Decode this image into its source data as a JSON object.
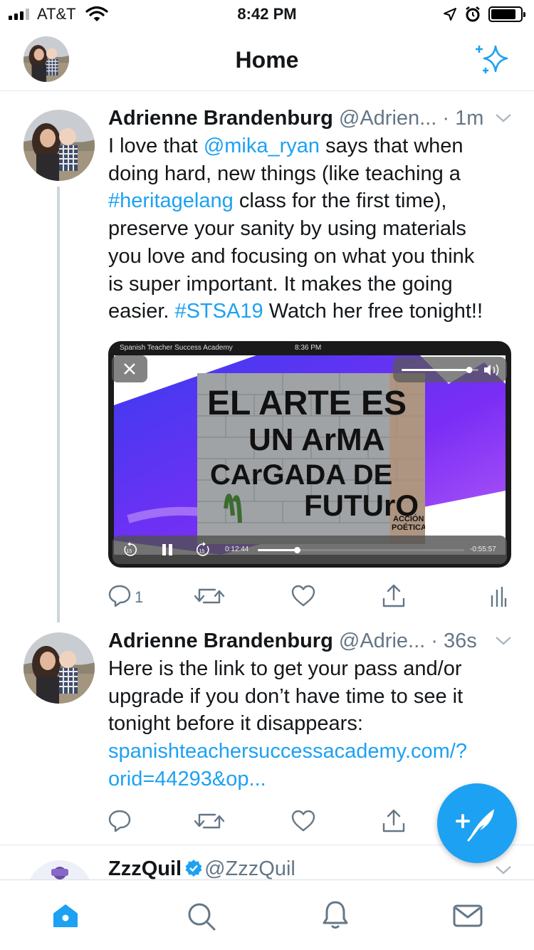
{
  "status_bar": {
    "carrier": "AT&T",
    "time": "8:42 PM"
  },
  "nav": {
    "title": "Home",
    "icons": [
      "avatar",
      "sparkle-icon"
    ]
  },
  "tweets": [
    {
      "name": "Adrienne Brandenburg",
      "handle": "@Adrien...",
      "separator": " · ",
      "time": "1m",
      "text_lines": [
        [
          {
            "t": "I love that "
          },
          {
            "t": "@mika_ryan",
            "link": true
          },
          {
            "t": " says that when"
          }
        ],
        [
          {
            "t": "doing hard, new things (like teaching a"
          }
        ],
        [
          {
            "t": "#heritagelang",
            "link": true
          },
          {
            "t": " class for the first time),"
          }
        ],
        [
          {
            "t": "preserve your sanity by using materials"
          }
        ],
        [
          {
            "t": "you love and focusing on what you think"
          }
        ],
        [
          {
            "t": "is super important. It makes the going"
          }
        ],
        [
          {
            "t": "easier. "
          },
          {
            "t": "#STSA19",
            "link": true
          },
          {
            "t": " Watch her free tonight!!"
          }
        ]
      ],
      "video": {
        "app_label": "Spanish Teacher Success Academy",
        "clock": "8:36 PM",
        "elapsed": "0:12:44",
        "remaining": "-0:55:57",
        "progress": 0.19,
        "volume": 0.88,
        "skip_seconds": "15",
        "wall_text": [
          "EL ARTE ES",
          "UN ArMA",
          "CArGADA DE",
          "FUTUrO"
        ],
        "stamp_text": [
          "ACCIÓN",
          "POÉTICA"
        ]
      },
      "reply_count": "1"
    },
    {
      "name": "Adrienne Brandenburg",
      "handle": "@Adrie...",
      "separator": " · ",
      "time": "36s",
      "text_lines": [
        [
          {
            "t": "Here is the link to get your pass and/or"
          }
        ],
        [
          {
            "t": "upgrade if you don’t have time to see it"
          }
        ],
        [
          {
            "t": "tonight before it disappears:"
          }
        ],
        [
          {
            "t": "spanishteachersuccessacademy.com/?",
            "link": true
          }
        ],
        [
          {
            "t": "orid=44293&op...",
            "link": true
          }
        ]
      ]
    },
    {
      "name": "ZzzQuil",
      "handle": "@ZzzQuil",
      "verified": true
    }
  ],
  "tab_bar": {
    "tabs": [
      "home-icon",
      "search-icon",
      "notifications-icon",
      "messages-icon"
    ]
  },
  "colors": {
    "accent": "#1da1f2",
    "text": "#14171a",
    "secondary": "#657786"
  }
}
